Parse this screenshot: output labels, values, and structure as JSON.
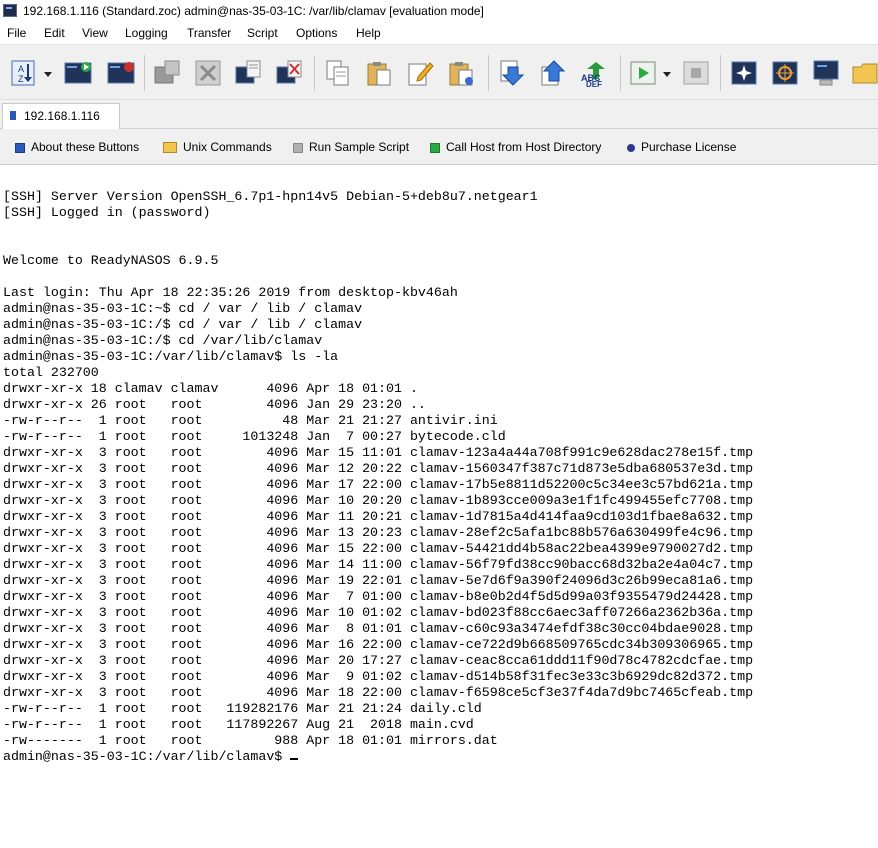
{
  "window": {
    "title": "192.168.1.116 (Standard.zoc) admin@nas-35-03-1C: /var/lib/clamav [evaluation mode]"
  },
  "menu": [
    "File",
    "Edit",
    "View",
    "Logging",
    "Transfer",
    "Script",
    "Options",
    "Help"
  ],
  "toolbar_icons": [
    "sort-az-icon",
    "new-session-icon",
    "session-prompt-icon",
    "disconnect-icon",
    "cancel-icon",
    "copy-screen-icon",
    "clear-screen-icon",
    "copy-icon",
    "paste-icon",
    "edit-icon",
    "paste-special-icon",
    "download-icon",
    "upload-icon",
    "abc-def-icon",
    "run-script-icon",
    "stop-icon",
    "compass-icon",
    "crosshair-icon",
    "terminal-monitor-icon",
    "folder-icon"
  ],
  "tab": {
    "label": "192.168.1.116"
  },
  "buttonbar": [
    {
      "label": "About these Buttons",
      "icon": "info-square-icon"
    },
    {
      "label": "Unix Commands",
      "icon": "folder-icon"
    },
    {
      "label": "Run Sample Script",
      "icon": "gray-square-icon"
    },
    {
      "label": "Call Host from Host Directory",
      "icon": "green-square-icon"
    },
    {
      "label": "Purchase License",
      "icon": "blue-dot-icon"
    }
  ],
  "terminal": {
    "lines": [
      "[SSH] Server Version OpenSSH_6.7p1-hpn14v5 Debian-5+deb8u7.netgear1",
      "[SSH] Logged in (password)",
      "",
      "",
      "Welcome to ReadyNASOS 6.9.5",
      "",
      "Last login: Thu Apr 18 22:35:26 2019 from desktop-kbv46ah",
      "admin@nas-35-03-1C:~$ cd / var / lib / clamav",
      "admin@nas-35-03-1C:/$ cd / var / lib / clamav",
      "admin@nas-35-03-1C:/$ cd /var/lib/clamav",
      "admin@nas-35-03-1C:/var/lib/clamav$ ls -la",
      "total 232700",
      "drwxr-xr-x 18 clamav clamav      4096 Apr 18 01:01 .",
      "drwxr-xr-x 26 root   root        4096 Jan 29 23:20 ..",
      "-rw-r--r--  1 root   root          48 Mar 21 21:27 antivir.ini",
      "-rw-r--r--  1 root   root     1013248 Jan  7 00:27 bytecode.cld",
      "drwxr-xr-x  3 root   root        4096 Mar 15 11:01 clamav-123a4a44a708f991c9e628dac278e15f.tmp",
      "drwxr-xr-x  3 root   root        4096 Mar 12 20:22 clamav-1560347f387c71d873e5dba680537e3d.tmp",
      "drwxr-xr-x  3 root   root        4096 Mar 17 22:00 clamav-17b5e8811d52200c5c34ee3c57bd621a.tmp",
      "drwxr-xr-x  3 root   root        4096 Mar 10 20:20 clamav-1b893cce009a3e1f1fc499455efc7708.tmp",
      "drwxr-xr-x  3 root   root        4096 Mar 11 20:21 clamav-1d7815a4d414faa9cd103d1fbae8a632.tmp",
      "drwxr-xr-x  3 root   root        4096 Mar 13 20:23 clamav-28ef2c5afa1bc88b576a630499fe4c96.tmp",
      "drwxr-xr-x  3 root   root        4096 Mar 15 22:00 clamav-54421dd4b58ac22bea4399e9790027d2.tmp",
      "drwxr-xr-x  3 root   root        4096 Mar 14 11:00 clamav-56f79fd38cc90bacc68d32ba2e4a04c7.tmp",
      "drwxr-xr-x  3 root   root        4096 Mar 19 22:01 clamav-5e7d6f9a390f24096d3c26b99eca81a6.tmp",
      "drwxr-xr-x  3 root   root        4096 Mar  7 01:00 clamav-b8e0b2d4f5d5d99a03f9355479d24428.tmp",
      "drwxr-xr-x  3 root   root        4096 Mar 10 01:02 clamav-bd023f88cc6aec3aff07266a2362b36a.tmp",
      "drwxr-xr-x  3 root   root        4096 Mar  8 01:01 clamav-c60c93a3474efdf38c30cc04bdae9028.tmp",
      "drwxr-xr-x  3 root   root        4096 Mar 16 22:00 clamav-ce722d9b668509765cdc34b309306965.tmp",
      "drwxr-xr-x  3 root   root        4096 Mar 20 17:27 clamav-ceac8cca61ddd11f90d78c4782cdcfae.tmp",
      "drwxr-xr-x  3 root   root        4096 Mar  9 01:02 clamav-d514b58f31fec3e33c3b6929dc82d372.tmp",
      "drwxr-xr-x  3 root   root        4096 Mar 18 22:00 clamav-f6598ce5cf3e37f4da7d9bc7465cfeab.tmp",
      "-rw-r--r--  1 root   root   119282176 Mar 21 21:24 daily.cld",
      "-rw-r--r--  1 root   root   117892267 Aug 21  2018 main.cvd",
      "-rw-------  1 root   root         988 Apr 18 01:01 mirrors.dat"
    ],
    "prompt": "admin@nas-35-03-1C:/var/lib/clamav$ "
  },
  "colors": {
    "toolbar_bg": "#f0f0f0",
    "tab_accent": "#2c58b8",
    "terminal_bg": "#ffffff"
  }
}
